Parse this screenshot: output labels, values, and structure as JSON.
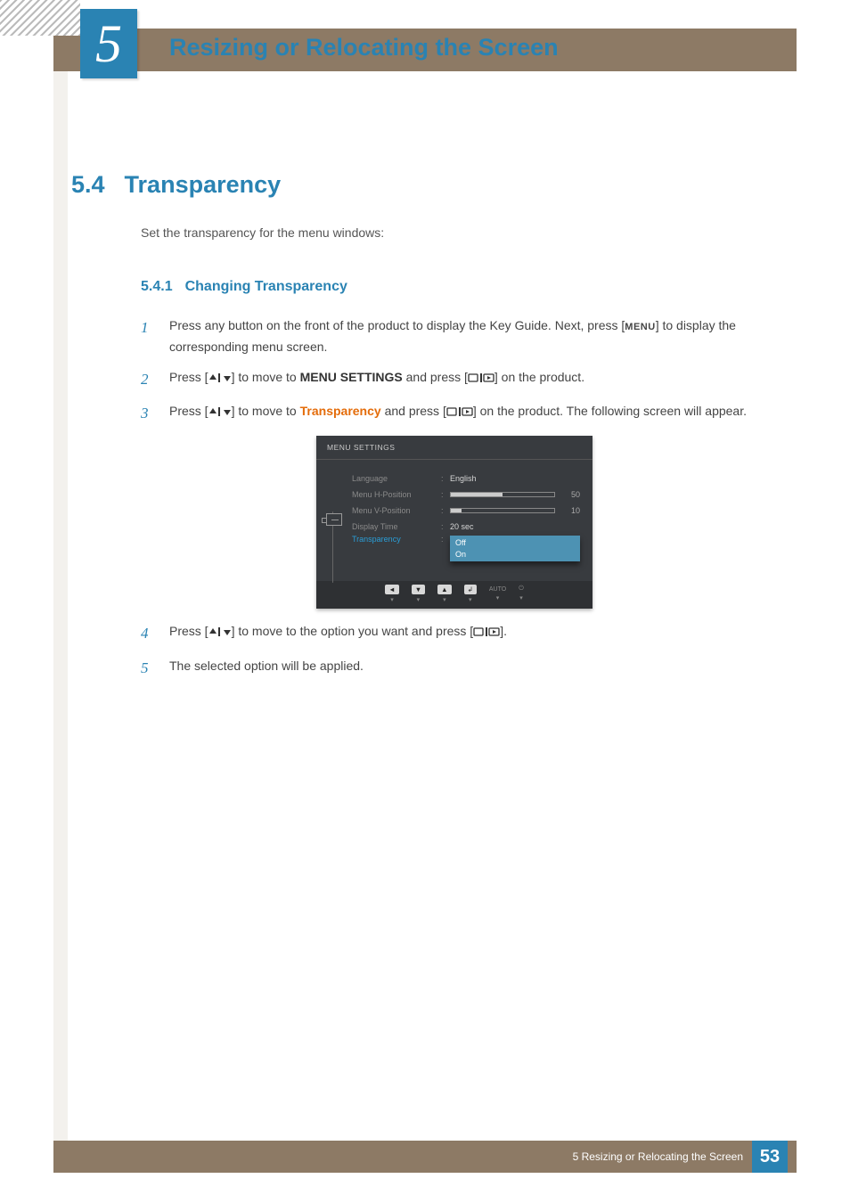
{
  "chapter": {
    "number": "5",
    "title": "Resizing or Relocating the Screen"
  },
  "section": {
    "number": "5.4",
    "title": "Transparency"
  },
  "intro": "Set the transparency for the menu windows:",
  "subsection": {
    "number": "5.4.1",
    "title": "Changing Transparency"
  },
  "steps": {
    "s1": {
      "num": "1",
      "pre": "Press any button on the front of the product to display the Key Guide. Next, press [",
      "btn": "MENU",
      "post": "] to display the corresponding menu screen."
    },
    "s2": {
      "num": "2",
      "pre": "Press [",
      "mid1": "] to move to ",
      "kw": "MENU SETTINGS",
      "mid2": " and press [",
      "post": "] on the product."
    },
    "s3": {
      "num": "3",
      "pre": "Press [",
      "mid1": "] to move to ",
      "kw": "Transparency",
      "mid2": " and press [",
      "post": "] on the product. The following screen will appear."
    },
    "s4": {
      "num": "4",
      "pre": "Press [",
      "mid1": "] to move to the option you want and press [",
      "post": "]."
    },
    "s5": {
      "num": "5",
      "text": "The selected option will be applied."
    }
  },
  "osd": {
    "header": "MENU SETTINGS",
    "rows": {
      "language": {
        "label": "Language",
        "value": "English"
      },
      "hpos": {
        "label": "Menu H-Position",
        "value": "50",
        "pct": 50
      },
      "vpos": {
        "label": "Menu V-Position",
        "value": "10",
        "pct": 10
      },
      "dtime": {
        "label": "Display Time",
        "value": "20 sec"
      },
      "transparency": {
        "label": "Transparency",
        "opt1": "Off",
        "opt2": "On"
      }
    },
    "footer": {
      "auto": "AUTO"
    }
  },
  "footer": {
    "text": "5 Resizing or Relocating the Screen",
    "page": "53"
  }
}
